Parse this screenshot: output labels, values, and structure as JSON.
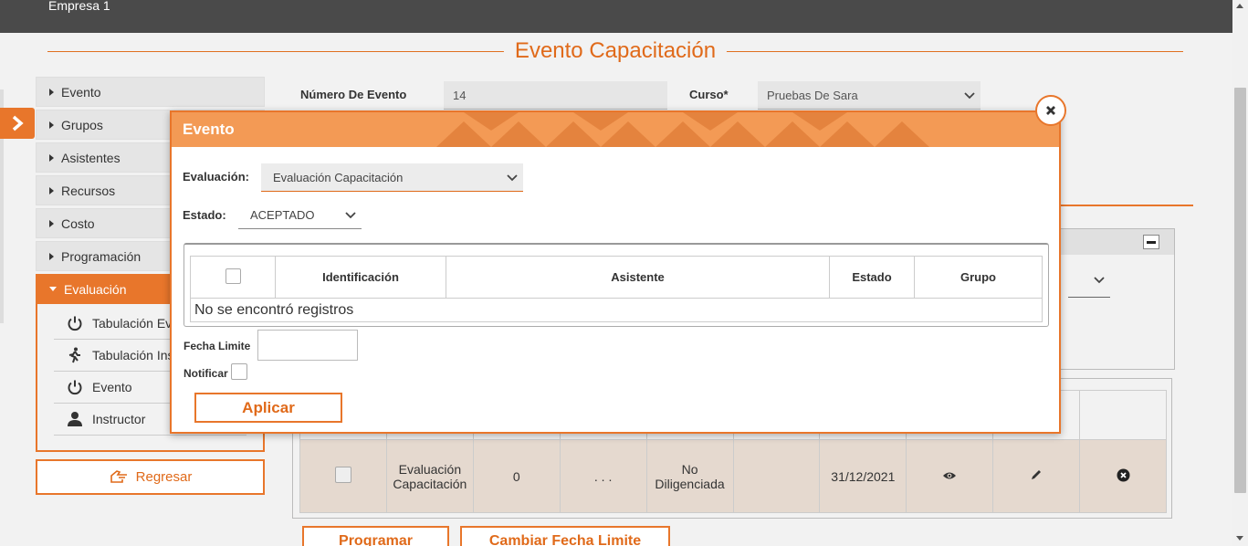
{
  "topbar": {
    "company": "Empresa 1"
  },
  "page": {
    "title": "Evento Capacitación"
  },
  "sidebar": {
    "items": [
      {
        "label": "Evento"
      },
      {
        "label": "Grupos"
      },
      {
        "label": "Asistentes"
      },
      {
        "label": "Recursos"
      },
      {
        "label": "Costo"
      },
      {
        "label": "Programación"
      },
      {
        "label": "Evaluación"
      }
    ],
    "subitems": [
      {
        "label": "Tabulación Evaluación",
        "icon": "power-icon"
      },
      {
        "label": "Tabulación Instructor",
        "icon": "walking-person-icon"
      },
      {
        "label": "Evento",
        "icon": "power-icon"
      },
      {
        "label": "Instructor",
        "icon": "user-icon"
      }
    ],
    "back_label": "Regresar"
  },
  "form": {
    "event_number_label": "Número De Evento",
    "event_number_value": "14",
    "course_label": "Curso*",
    "course_value": "Pruebas De Sara"
  },
  "grid": {
    "row": {
      "evaluation": "Evaluación Capacitación",
      "count": "0",
      "dots": ". . .",
      "status": "No Diligenciada",
      "date": "31/12/2021"
    }
  },
  "buttons": {
    "programar": "Programar",
    "cambiar_fecha": "Cambiar Fecha Limite"
  },
  "modal": {
    "title": "Evento",
    "evaluation_label": "Evaluación:",
    "evaluation_value": "Evaluación Capacitación",
    "state_label": "Estado:",
    "state_value": "ACEPTADO",
    "columns": [
      "Identificación",
      "Asistente",
      "Estado",
      "Grupo"
    ],
    "empty_message": "No se encontró registros",
    "deadline_label": "Fecha Limite",
    "deadline_value": "",
    "notify_label": "Notificar",
    "apply_label": "Aplicar"
  },
  "colors": {
    "accent": "#e8762b",
    "header_bg": "#f39a55",
    "topbar": "#4a4a4a"
  }
}
